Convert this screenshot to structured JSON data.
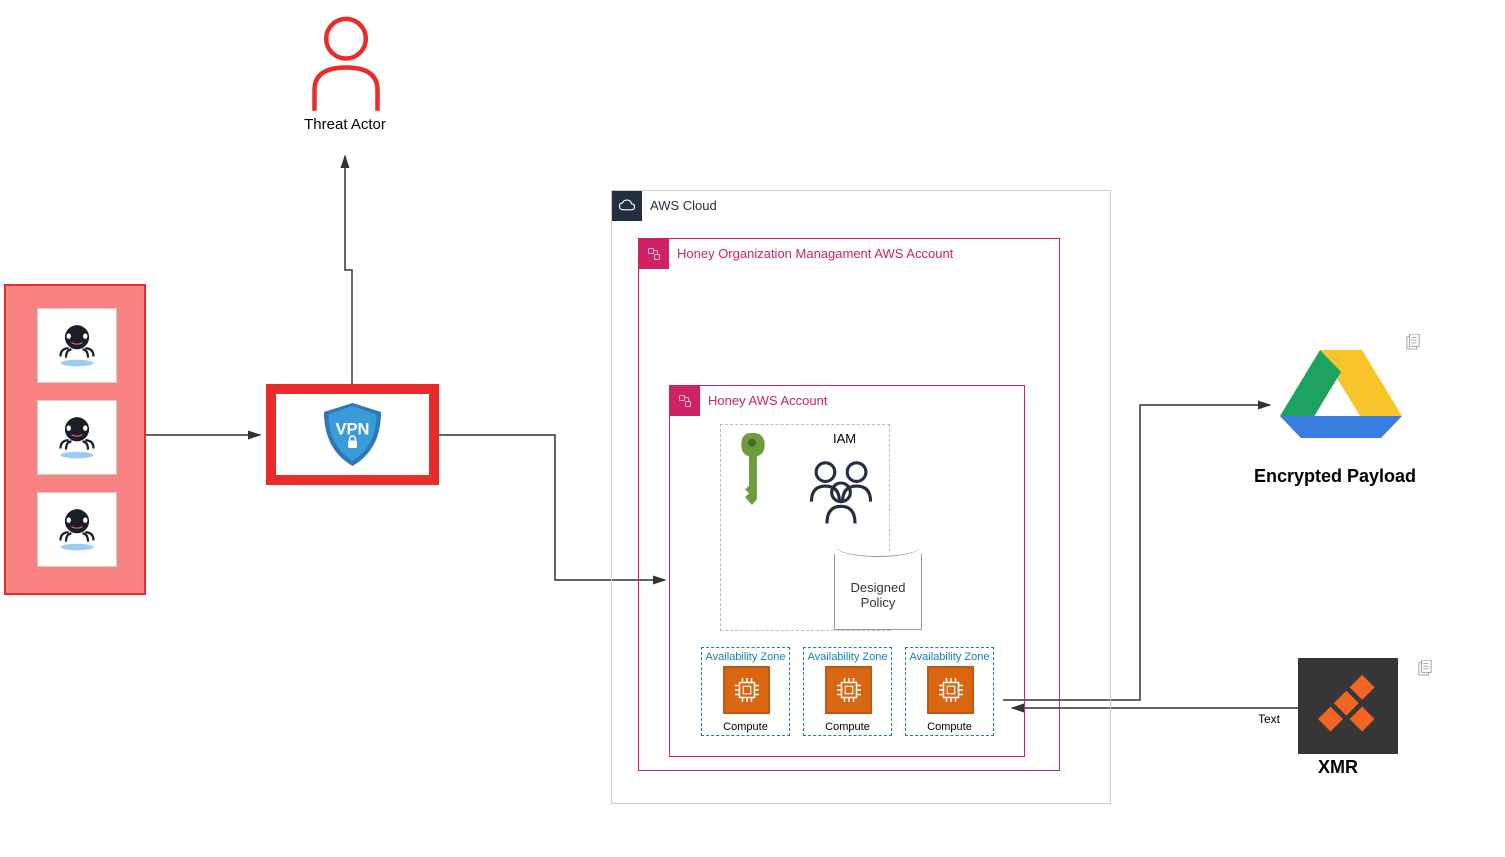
{
  "actor": {
    "label": "Threat Actor"
  },
  "vpn": {
    "label": "VPN"
  },
  "aws": {
    "cloud_title": "AWS Cloud",
    "org_title": "Honey Organization Managament AWS Account",
    "honey_title": "Honey AWS Account",
    "iam_title": "IAM",
    "policy_label": "Designed Policy",
    "az_title": "Availability Zone",
    "compute_label": "Compute"
  },
  "payload": {
    "label": "Encrypted Payload"
  },
  "xmr": {
    "label": "XMR"
  },
  "edge": {
    "text_label": "Text"
  }
}
